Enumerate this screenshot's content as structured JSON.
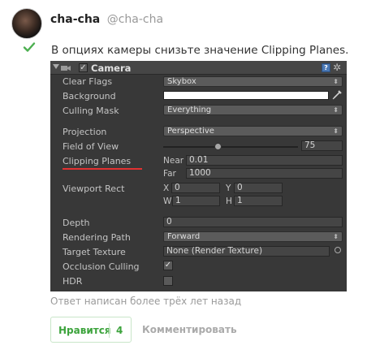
{
  "post": {
    "author_name": "cha-cha",
    "author_handle": "@cha-cha",
    "answer_text": "В опциях камеры снизьте значение Clipping Planes.",
    "meta_text": "Ответ написан более трёх лет назад",
    "like_label": "Нравится",
    "like_count": "4",
    "comment_label": "Комментировать",
    "accent_color": "#3ca33c"
  },
  "inspector": {
    "component_title": "Camera",
    "enabled_mark": "✓",
    "help_glyph": "?",
    "gear_glyph": "✲",
    "clear_flags": {
      "label": "Clear Flags",
      "value": "Skybox"
    },
    "background": {
      "label": "Background",
      "color": "#ffffff"
    },
    "culling_mask": {
      "label": "Culling Mask",
      "value": "Everything"
    },
    "projection": {
      "label": "Projection",
      "value": "Perspective"
    },
    "field_of_view": {
      "label": "Field of View",
      "value": "75"
    },
    "clipping_planes": {
      "label": "Clipping Planes",
      "near_label": "Near",
      "near_value": "0.01",
      "far_label": "Far",
      "far_value": "1000",
      "highlight_color": "#e23232"
    },
    "viewport_rect": {
      "label": "Viewport Rect",
      "x_label": "X",
      "x_value": "0",
      "y_label": "Y",
      "y_value": "0",
      "w_label": "W",
      "w_value": "1",
      "h_label": "H",
      "h_value": "1"
    },
    "depth": {
      "label": "Depth",
      "value": "0"
    },
    "rendering_path": {
      "label": "Rendering Path",
      "value": "Forward"
    },
    "target_texture": {
      "label": "Target Texture",
      "value": "None (Render Texture)"
    },
    "occlusion_culling": {
      "label": "Occlusion Culling",
      "checked_mark": "✓"
    },
    "hdr": {
      "label": "HDR",
      "checked_mark": ""
    },
    "dropdown_arrows": "⬍"
  }
}
